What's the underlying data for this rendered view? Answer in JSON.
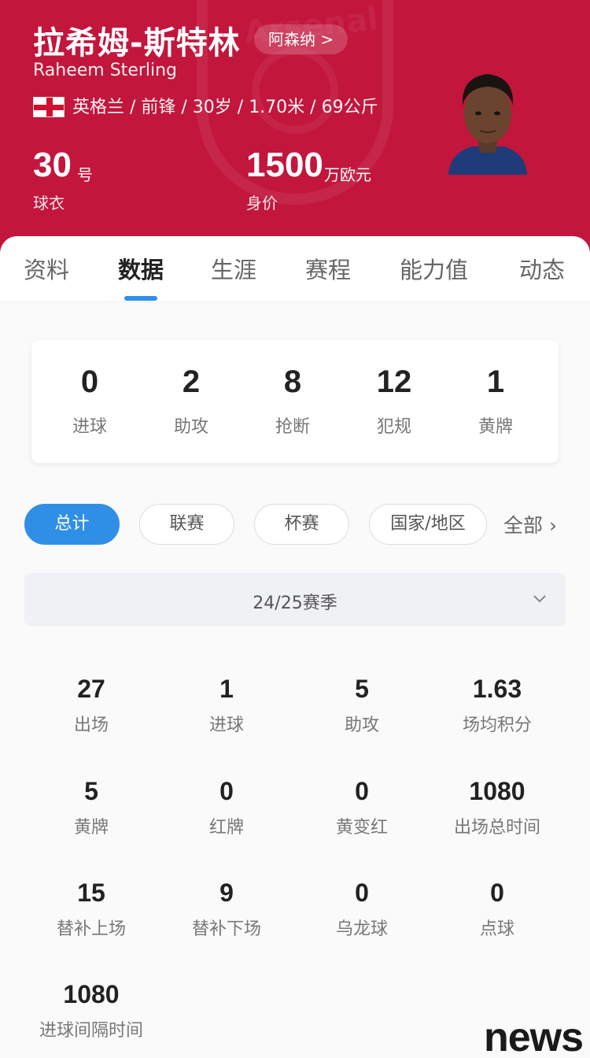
{
  "header": {
    "name_cn": "拉希姆-斯特林",
    "club": "阿森纳 >",
    "name_en": "Raheem Sterling",
    "meta": "英格兰 / 前锋 / 30岁 / 1.70米 / 69公斤",
    "jersey": {
      "value": "30",
      "unit": "号",
      "label": "球衣"
    },
    "market": {
      "value": "1500",
      "unit": "万欧元",
      "label": "身价"
    },
    "bg_color": "#c2163c"
  },
  "tabs": [
    "资料",
    "数据",
    "生涯",
    "赛程",
    "能力值",
    "动态"
  ],
  "active_tab": "数据",
  "summary": [
    {
      "value": "0",
      "label": "进球"
    },
    {
      "value": "2",
      "label": "助攻"
    },
    {
      "value": "8",
      "label": "抢断"
    },
    {
      "value": "12",
      "label": "犯规"
    },
    {
      "value": "1",
      "label": "黄牌"
    }
  ],
  "filters": [
    "总计",
    "联赛",
    "杯赛",
    "国家/地区"
  ],
  "filter_all": "全部 ›",
  "season": "24/25赛季",
  "stats": [
    {
      "value": "27",
      "label": "出场"
    },
    {
      "value": "1",
      "label": "进球"
    },
    {
      "value": "5",
      "label": "助攻"
    },
    {
      "value": "1.63",
      "label": "场均积分"
    },
    {
      "value": "5",
      "label": "黄牌"
    },
    {
      "value": "0",
      "label": "红牌"
    },
    {
      "value": "0",
      "label": "黄变红"
    },
    {
      "value": "1080",
      "label": "出场总时间"
    },
    {
      "value": "15",
      "label": "替补上场"
    },
    {
      "value": "9",
      "label": "替补下场"
    },
    {
      "value": "0",
      "label": "乌龙球"
    },
    {
      "value": "0",
      "label": "点球"
    },
    {
      "value": "1080",
      "label": "进球间隔时间"
    }
  ],
  "watermark": "news",
  "accent_color": "#2f8fe6"
}
